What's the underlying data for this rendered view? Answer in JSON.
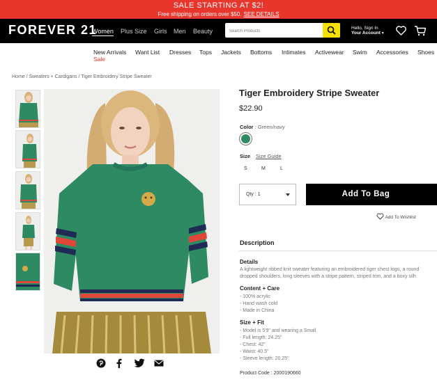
{
  "promo": {
    "headline": "SALE STARTING AT $2!",
    "subline": "Free shipping on orders over $50.",
    "details_link": "SEE DETAILS"
  },
  "header": {
    "logo": "FOREVER 21",
    "gender_tabs": [
      "Women",
      "Plus Size",
      "Girls",
      "Men",
      "Beauty"
    ],
    "search_placeholder": "Search Products",
    "account_line1": "Hello, Sign In",
    "account_line2": "Your Account"
  },
  "subnav": {
    "items": [
      "New Arrivals",
      "Want List",
      "Dresses",
      "Tops",
      "Jackets",
      "Bottoms",
      "Intimates",
      "Activewear",
      "Swim",
      "Accessories",
      "Shoes"
    ],
    "sale": "Sale"
  },
  "breadcrumb": "Home / Sweaters + Cardigans / Tiger Embroidery Stripe Sweater",
  "product": {
    "title": "Tiger Embroidery Stripe Sweater",
    "price": "$22.90",
    "color_label": "Color",
    "color_value": ": Green/navy",
    "swatch_color": "#2e8a63",
    "size_label": "Size",
    "size_guide": "Size Guide",
    "sizes": [
      "S",
      "M",
      "L"
    ],
    "qty_label": "Qty : 1",
    "add_to_bag": "Add To Bag",
    "wishlist": "Add To Wishlist"
  },
  "description": {
    "title": "Description",
    "details_h": "Details",
    "details_l1": "A lightweight ribbed knit sweater featuring an embroidered tiger chest logo, a round",
    "details_l2": "dropped shoulders, long sleeves with a stripe pattern, striped trim, and a boxy silh",
    "content_h": "Content + Care",
    "content_lines": [
      "- 100% acrylic",
      "- Hand wash cold",
      "- Made in China"
    ],
    "size_fit_h": "Size + Fit",
    "size_fit_lines": [
      "- Model is 5'9\" and wearing a Small",
      "- Full length: 24.25\"",
      "- Chest: 42\"",
      "- Waist: 40.5\"",
      "- Sleeve length: 20.25\""
    ],
    "product_code": "Product Code : 2000190660"
  },
  "colors": {
    "promo_red": "#e8362d",
    "search_yellow": "#f5e100",
    "sweater_green": "#2e8a63"
  }
}
